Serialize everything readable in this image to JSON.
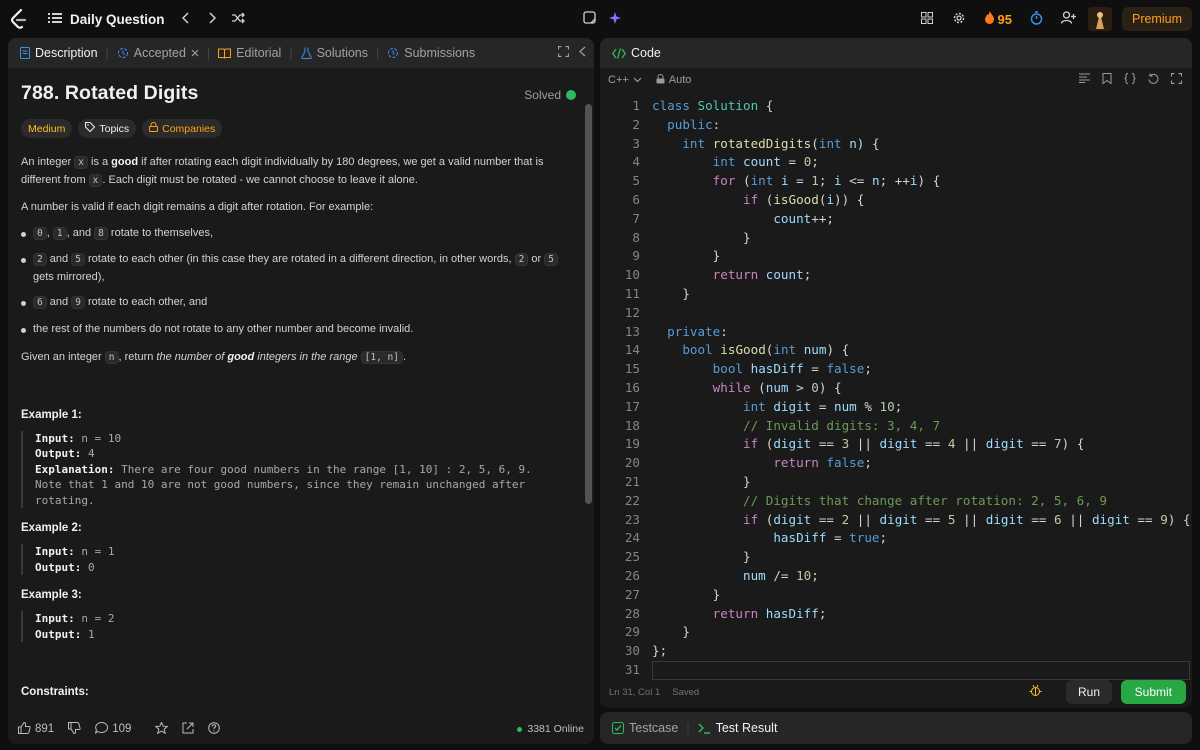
{
  "topbar": {
    "daily_question": "Daily Question",
    "streak": "95",
    "premium": "Premium"
  },
  "left_tabs": {
    "description": "Description",
    "accepted": "Accepted",
    "editorial": "Editorial",
    "solutions": "Solutions",
    "submissions": "Submissions"
  },
  "problem": {
    "title": "788. Rotated Digits",
    "status": "Solved",
    "difficulty": "Medium",
    "topics": "Topics",
    "companies": "Companies",
    "p1_a": "An integer ",
    "p1_x": "x",
    "p1_b": " is a ",
    "p1_good": "good",
    "p1_c": " if after rotating each digit individually by 180 degrees, we get a valid number that is different from ",
    "p1_x2": "x",
    "p1_d": ". Each digit must be rotated - we cannot choose to leave it alone.",
    "p2": "A number is valid if each digit remains a digit after rotation. For example:",
    "li1_c0": "0",
    "li1_c1": "1",
    "li1_and": ", and ",
    "li1_c8": "8",
    "li1_t": " rotate to themselves,",
    "li2_c2": "2",
    "li2_and": " and ",
    "li2_c5": "5",
    "li2_t": " rotate to each other (in this case they are rotated in a different direction, in other words, ",
    "li2_c2b": "2",
    "li2_or": " or ",
    "li2_c5b": "5",
    "li2_t2": " gets mirrored),",
    "li3_c6": "6",
    "li3_and": " and ",
    "li3_c9": "9",
    "li3_t": " rotate to each other, and",
    "li4": "the rest of the numbers do not rotate to any other number and become invalid.",
    "p3_a": "Given an integer ",
    "p3_n": "n",
    "p3_b": ", return ",
    "p3_i1": "the number of ",
    "p3_good": "good",
    "p3_i2": " integers in the range ",
    "p3_range": "[1, n]",
    "p3_end": ".",
    "examples": [
      {
        "heading": "Example 1:",
        "input_label": "Input:",
        "input": "n = 10",
        "output_label": "Output:",
        "output": "4",
        "expl_label": "Explanation:",
        "expl": "There are four good numbers in the range [1, 10] : 2, 5, 6, 9.",
        "expl2": "Note that 1 and 10 are not good numbers, since they remain unchanged after",
        "expl3": "rotating."
      },
      {
        "heading": "Example 2:",
        "input_label": "Input:",
        "input": "n = 1",
        "output_label": "Output:",
        "output": "0"
      },
      {
        "heading": "Example 3:",
        "input_label": "Input:",
        "input": "n = 2",
        "output_label": "Output:",
        "output": "1"
      }
    ],
    "constraints": "Constraints:"
  },
  "left_footer": {
    "likes": "891",
    "comments": "109",
    "online": "3381 Online"
  },
  "code_panel": {
    "tab": "Code",
    "language": "C++",
    "mode": "Auto",
    "status_pos": "Ln 31, Col 1",
    "status_saved": "Saved",
    "run": "Run",
    "submit": "Submit"
  },
  "bottom_tabs": {
    "testcase": "Testcase",
    "test_result": "Test Result"
  },
  "code_lines": [
    "class Solution {",
    "  public:",
    "    int rotatedDigits(int n) {",
    "        int count = 0;",
    "        for (int i = 1; i <= n; ++i) {",
    "            if (isGood(i)) {",
    "                count++;",
    "            }",
    "        }",
    "        return count;",
    "    }",
    "",
    "  private:",
    "    bool isGood(int num) {",
    "        bool hasDiff = false;",
    "        while (num > 0) {",
    "            int digit = num % 10;",
    "            // Invalid digits: 3, 4, 7",
    "            if (digit == 3 || digit == 4 || digit == 7) {",
    "                return false;",
    "            }",
    "            // Digits that change after rotation: 2, 5, 6, 9",
    "            if (digit == 2 || digit == 5 || digit == 6 || digit == 9) {",
    "                hasDiff = true;",
    "            }",
    "            num /= 10;",
    "        }",
    "        return hasDiff;",
    "    }",
    "};",
    ""
  ],
  "colors": {
    "accent": "#ffa116",
    "submit": "#28a745",
    "solved": "#2cbb5d",
    "medium": "#ffc01e"
  }
}
